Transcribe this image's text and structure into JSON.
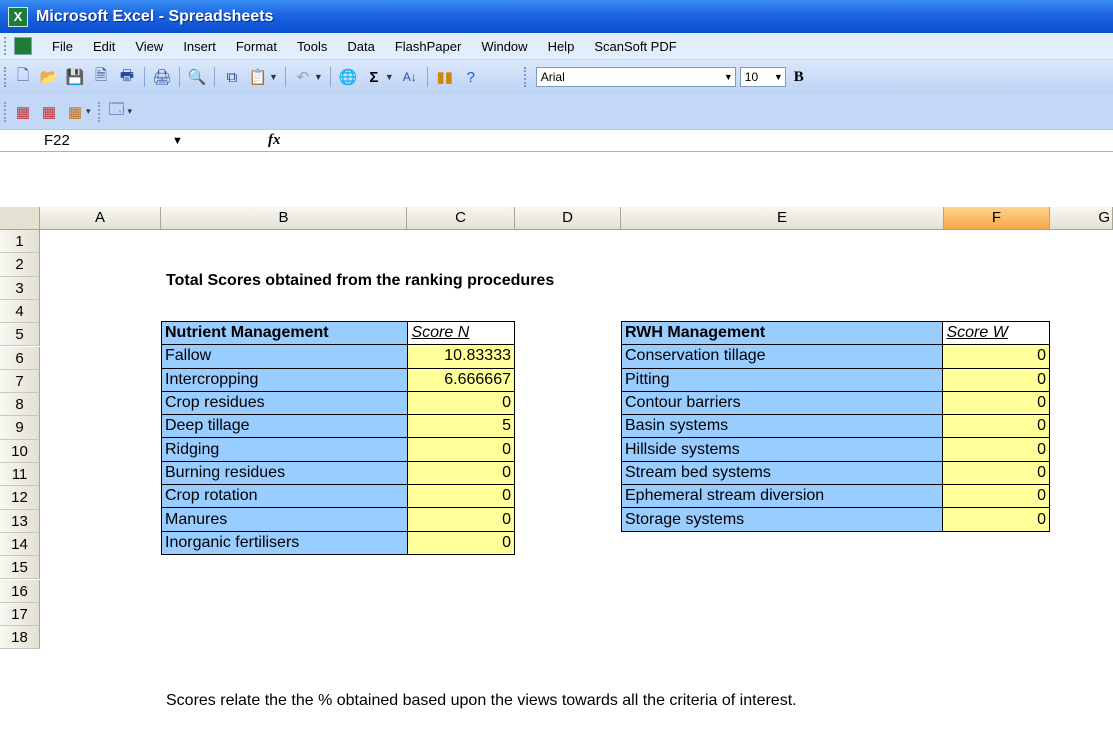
{
  "window": {
    "title": "Microsoft Excel - Spreadsheets"
  },
  "menu": [
    "File",
    "Edit",
    "View",
    "Insert",
    "Format",
    "Tools",
    "Data",
    "FlashPaper",
    "Window",
    "Help",
    "ScanSoft PDF"
  ],
  "toolbar": {
    "font_name": "Arial",
    "font_size": "10",
    "bold_label": "B"
  },
  "formula_bar": {
    "name_box": "F22",
    "fx_label": "fx",
    "formula": ""
  },
  "columns": [
    "A",
    "B",
    "C",
    "D",
    "E",
    "F",
    "G"
  ],
  "selected_column": "F",
  "rows": [
    "1",
    "2",
    "3",
    "4",
    "5",
    "6",
    "7",
    "8",
    "9",
    "10",
    "11",
    "12",
    "13",
    "14",
    "15",
    "16",
    "17",
    "18"
  ],
  "sheet": {
    "heading": "Total Scores obtained from the ranking procedures",
    "footnote": "Scores relate the the % obtained based upon the views towards all the criteria of interest."
  },
  "nutrient_table": {
    "header_label": "Nutrient Management",
    "header_value": "Score N",
    "rows": [
      {
        "label": "Fallow",
        "value": "10.83333"
      },
      {
        "label": "Intercropping",
        "value": "6.666667"
      },
      {
        "label": "Crop residues",
        "value": "0"
      },
      {
        "label": "Deep tillage",
        "value": "5"
      },
      {
        "label": "Ridging",
        "value": "0"
      },
      {
        "label": "Burning residues",
        "value": "0"
      },
      {
        "label": "Crop rotation",
        "value": "0"
      },
      {
        "label": "Manures",
        "value": "0"
      },
      {
        "label": "Inorganic fertilisers",
        "value": "0"
      }
    ]
  },
  "rwh_table": {
    "header_label": "RWH Management",
    "header_value": "Score W",
    "rows": [
      {
        "label": "Conservation tillage",
        "value": "0"
      },
      {
        "label": "Pitting",
        "value": "0"
      },
      {
        "label": "Contour barriers",
        "value": "0"
      },
      {
        "label": "Basin systems",
        "value": "0"
      },
      {
        "label": "Hillside systems",
        "value": "0"
      },
      {
        "label": "Stream bed systems",
        "value": "0"
      },
      {
        "label": "Ephemeral stream diversion",
        "value": "0"
      },
      {
        "label": "Storage systems",
        "value": "0"
      }
    ]
  },
  "colors": {
    "label_fill": "#99ccff",
    "value_fill": "#ffff99",
    "selected_header": "#f7a64b"
  }
}
